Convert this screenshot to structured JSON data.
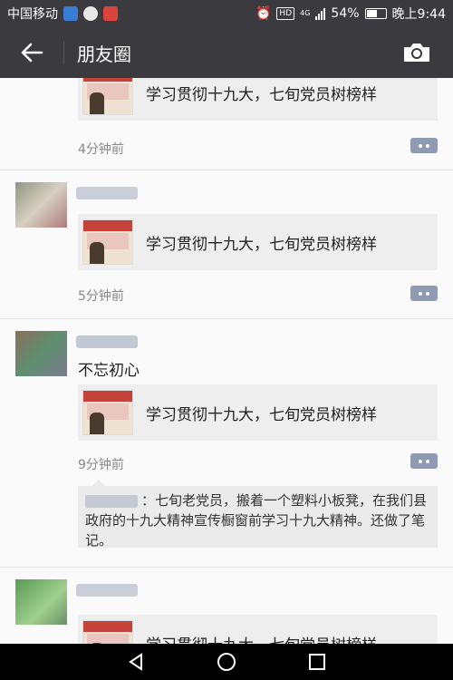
{
  "status_bar": {
    "carrier": "中国移动",
    "network": "4G",
    "battery": "54%",
    "time": "晚上9:44",
    "hd_label": "HD"
  },
  "header": {
    "title": "朋友圈",
    "back_icon": "arrow-left-icon",
    "camera_icon": "camera-icon"
  },
  "posts": [
    {
      "share_title": "学习贯彻十九大，七旬党员树榜样",
      "time": "4分钟前"
    },
    {
      "share_title": "学习贯彻十九大，七旬党员树榜样",
      "time": "5分钟前"
    },
    {
      "text": "不忘初心",
      "share_title": "学习贯彻十九大，七旬党员树榜样",
      "time": "9分钟前",
      "comment": "：七旬老党员，搬着一个塑料小板凳，在我们县政府的十九大精神宣传橱窗前学习十九大精神。还做了笔记。"
    },
    {
      "share_title": "学习贯彻十九大，七旬党员树榜样"
    }
  ],
  "colors": {
    "header_bg": "#3a3a3f",
    "comment_btn": "#8f9bb2"
  }
}
